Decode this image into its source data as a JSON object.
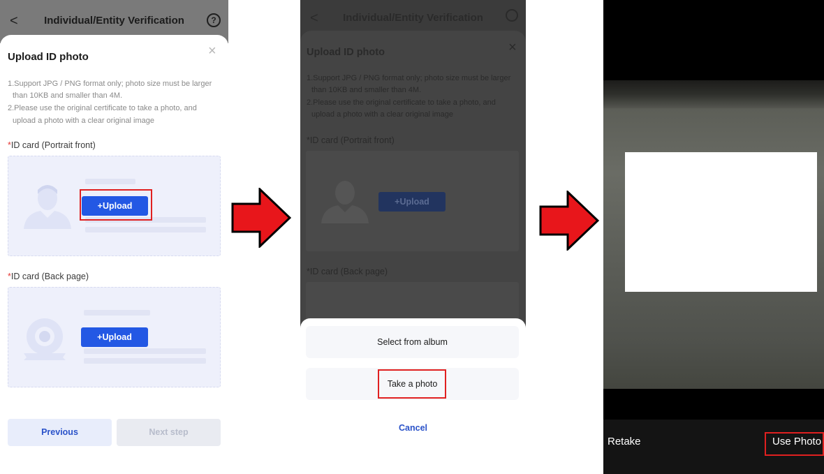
{
  "panel1": {
    "header_title": "Individual/Entity Verification",
    "help_icon": "?",
    "back_icon": "<",
    "sheet_title": "Upload ID photo",
    "close_icon": "×",
    "notes": [
      "1.Support JPG / PNG format only; photo size must be larger",
      "than 10KB and smaller than 4M.",
      "2.Please use the original certificate to take a photo, and",
      "upload a photo with a clear original image"
    ],
    "required_mark": "*",
    "front_label": "ID card (Portrait front)",
    "back_label": "ID card (Back page)",
    "upload_label": "Upload",
    "plus": "+",
    "previous_label": "Previous",
    "next_label": "Next step"
  },
  "panel2": {
    "header_title": "Individual/Entity Verification",
    "sheet_title": "Upload ID photo",
    "notes": [
      "1.Support JPG / PNG format only; photo size must be larger",
      "than 10KB and smaller than 4M.",
      "2.Please use the original certificate to take a photo, and",
      "upload a photo with a clear original image"
    ],
    "front_label": "*ID card (Portrait front)",
    "back_label": "*ID card (Back page)",
    "upload_label": "+Upload",
    "option_album": "Select from album",
    "option_take_photo": "Take a photo",
    "cancel_label": "Cancel"
  },
  "panel3": {
    "retake_label": "Retake",
    "use_photo_label": "Use Photo"
  },
  "colors": {
    "accent_blue": "#2358e4",
    "highlight_red": "#e02020",
    "arrow_red": "#e8161b"
  }
}
